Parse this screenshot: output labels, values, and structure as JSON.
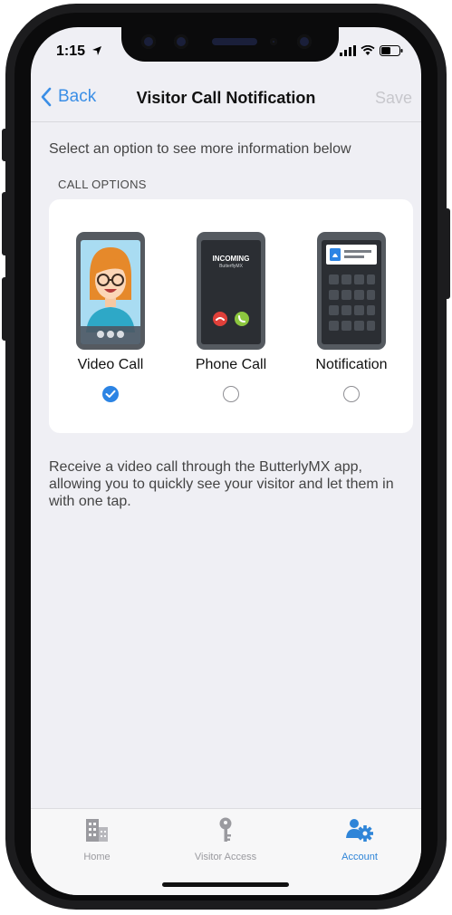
{
  "status_bar": {
    "time": "1:15"
  },
  "nav": {
    "back_label": "Back",
    "title": "Visitor Call Notification",
    "save_label": "Save"
  },
  "hint": "Select an option to see more information below",
  "section_header": "CALL OPTIONS",
  "options": [
    {
      "label": "Video Call",
      "selected": true
    },
    {
      "label": "Phone Call",
      "selected": false,
      "screen_title": "INCOMING",
      "screen_subtitle": "ButterflyMX"
    },
    {
      "label": "Notification",
      "selected": false
    }
  ],
  "description": "Receive a video call through the ButterlyMX app, allowing you to quickly see your visitor and let them in with one tap.",
  "tabs": [
    {
      "label": "Home",
      "icon": "building-icon",
      "active": false
    },
    {
      "label": "Visitor Access",
      "icon": "key-icon",
      "active": false
    },
    {
      "label": "Account",
      "icon": "user-gear-icon",
      "active": true
    }
  ],
  "colors": {
    "accent": "#2c84e4",
    "background": "#efeff4",
    "save_disabled": "#c7c7cc"
  }
}
